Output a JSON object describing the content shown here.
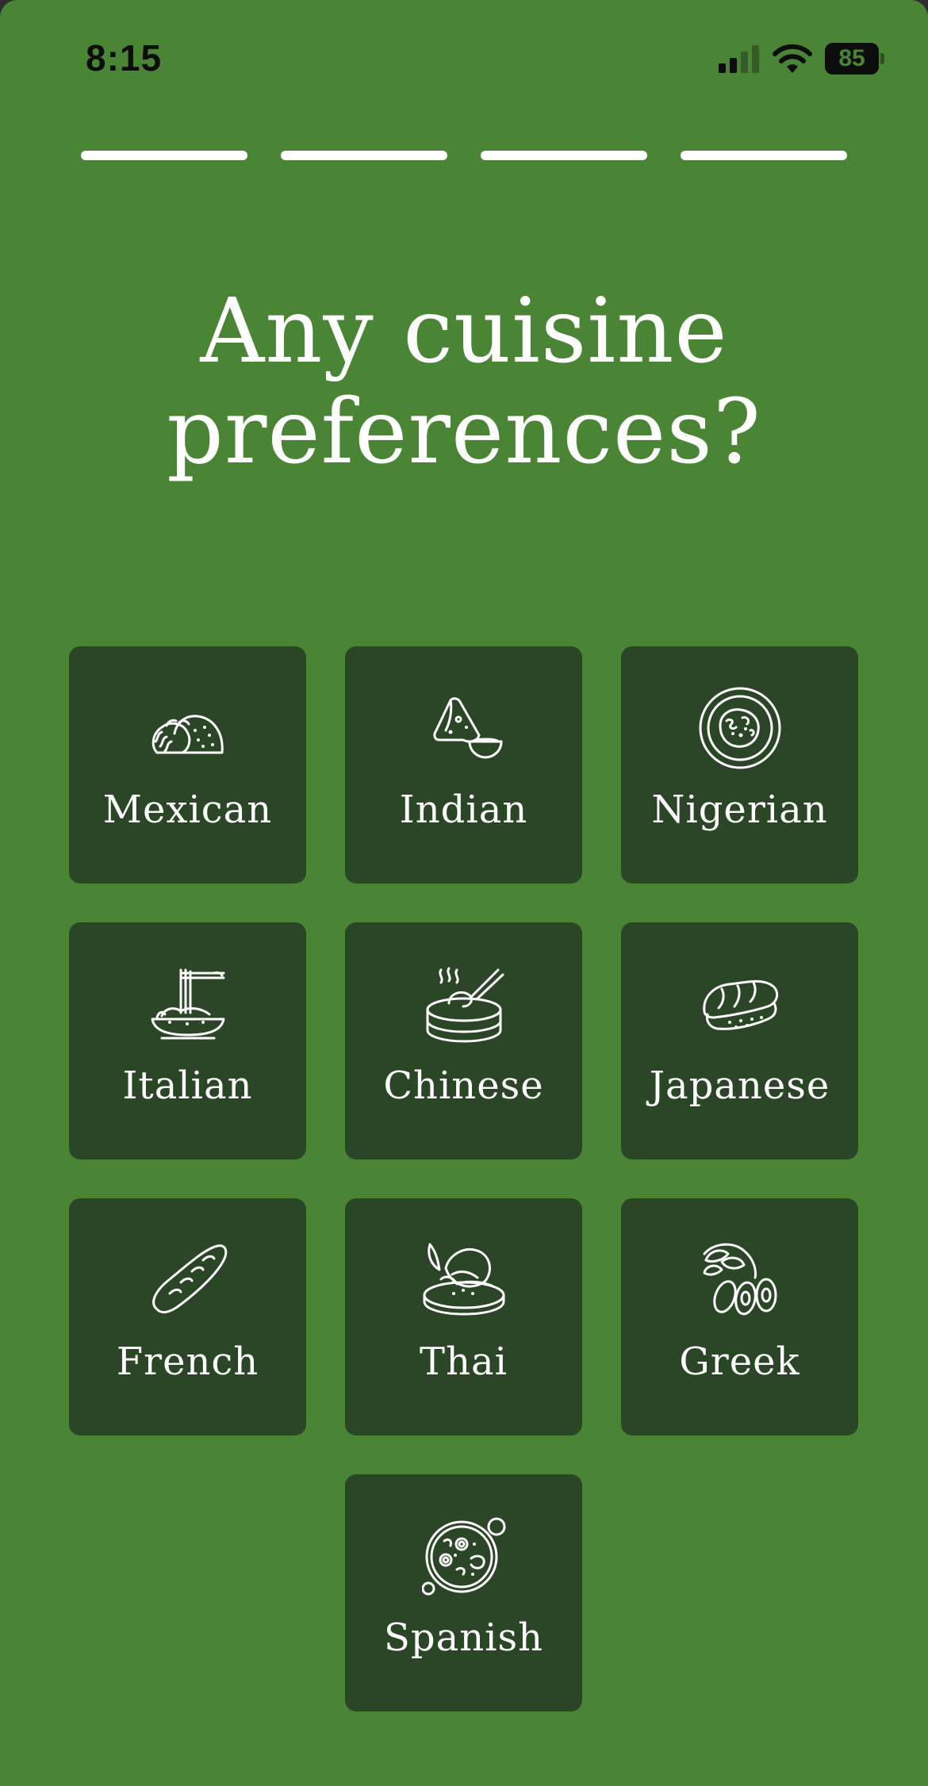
{
  "status_bar": {
    "time": "8:15",
    "battery": "85"
  },
  "progress": {
    "segments_total": 4,
    "segments_completed": 4
  },
  "question": {
    "line1": "Any cuisine",
    "line2": "preferences?"
  },
  "cuisines": [
    {
      "label": "Mexican",
      "icon": "taco-icon"
    },
    {
      "label": "Indian",
      "icon": "samosa-icon"
    },
    {
      "label": "Nigerian",
      "icon": "jollof-plate-icon"
    },
    {
      "label": "Italian",
      "icon": "spaghetti-icon"
    },
    {
      "label": "Chinese",
      "icon": "dim-sum-steamer-icon"
    },
    {
      "label": "Japanese",
      "icon": "sushi-icon"
    },
    {
      "label": "French",
      "icon": "baguette-icon"
    },
    {
      "label": "Thai",
      "icon": "mango-sticky-rice-icon"
    },
    {
      "label": "Greek",
      "icon": "olives-icon"
    },
    {
      "label": "Spanish",
      "icon": "paella-pan-icon"
    }
  ],
  "colors": {
    "background": "#4a8535",
    "tile": "#2b4626",
    "text": "#ffffff"
  }
}
